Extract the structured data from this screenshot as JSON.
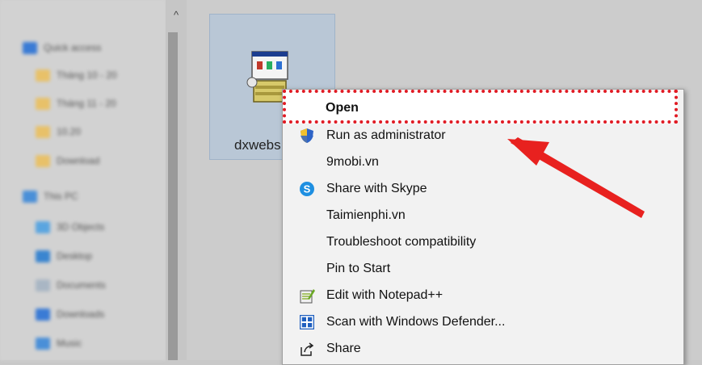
{
  "navigation": {
    "items": [
      {
        "label": "Quick access",
        "icon": "star-icon",
        "color": "#3a7bd5",
        "indent": false
      },
      {
        "label": "Tháng 10 - 20",
        "icon": "folder-icon",
        "color": "#e8c169",
        "indent": true
      },
      {
        "label": "Tháng 11 - 20",
        "icon": "folder-icon",
        "color": "#e8c169",
        "indent": true
      },
      {
        "label": "10.20",
        "icon": "folder-icon",
        "color": "#e8c169",
        "indent": true
      },
      {
        "label": "Download",
        "icon": "folder-icon",
        "color": "#e8c169",
        "indent": true
      },
      {
        "label": "This PC",
        "icon": "computer-icon",
        "color": "#4a8fd8",
        "indent": false
      },
      {
        "label": "3D Objects",
        "icon": "cube-icon",
        "color": "#5aa5e0",
        "indent": true
      },
      {
        "label": "Desktop",
        "icon": "desktop-icon",
        "color": "#3a85d0",
        "indent": true
      },
      {
        "label": "Documents",
        "icon": "document-icon",
        "color": "#a9b6c4",
        "indent": true
      },
      {
        "label": "Downloads",
        "icon": "download-icon",
        "color": "#3a7bd5",
        "indent": true
      },
      {
        "label": "Music",
        "icon": "music-icon",
        "color": "#4a8fd8",
        "indent": true
      }
    ]
  },
  "file": {
    "name": "dxwebs",
    "icon": "installer-icon"
  },
  "context_menu": {
    "items": [
      {
        "label": "Open",
        "icon": "",
        "bold": true
      },
      {
        "label": "Run as administrator",
        "icon": "shield-icon",
        "bold": false
      },
      {
        "label": "9mobi.vn",
        "icon": "",
        "bold": false
      },
      {
        "label": "Share with Skype",
        "icon": "skype-icon",
        "bold": false
      },
      {
        "label": "Taimienphi.vn",
        "icon": "",
        "bold": false
      },
      {
        "label": "Troubleshoot compatibility",
        "icon": "",
        "bold": false
      },
      {
        "label": "Pin to Start",
        "icon": "",
        "bold": false
      },
      {
        "label": "Edit with Notepad++",
        "icon": "notepadpp-icon",
        "bold": false
      },
      {
        "label": "Scan with Windows Defender...",
        "icon": "defender-icon",
        "bold": false
      },
      {
        "label": "Share",
        "icon": "share-icon",
        "bold": false
      }
    ]
  },
  "annotation": {
    "highlight_color": "#e01b24",
    "arrow_color": "#e8211f"
  }
}
